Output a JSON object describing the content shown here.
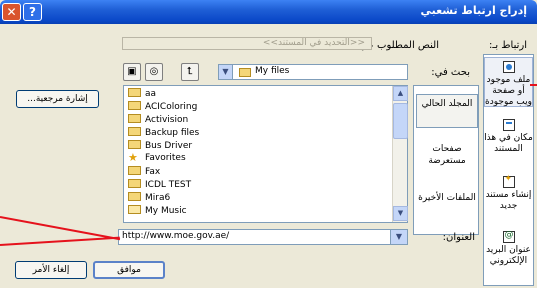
{
  "title_bar": {
    "title": "إدراج ارتباط تشعبي",
    "help_glyph": "?",
    "close_glyph": "✕"
  },
  "labels": {
    "link_to": "ارتباط بـ:",
    "text_to_display": "النص المطلوب عرضه:",
    "look_in": "بحث في:",
    "address": "العنوان:"
  },
  "text_to_display_value": "<<التحديد في المستند>>",
  "link_to_items": [
    {
      "label": "ملف موجود أو صفحة ويب موجودة",
      "icon": "web-page-icon",
      "selected": true
    },
    {
      "label": "مكان في هذا المستند",
      "icon": "document-place-icon",
      "selected": false
    },
    {
      "label": "إنشاء مستند جديد",
      "icon": "new-document-icon",
      "selected": false
    },
    {
      "label": "عنوان البريد الإلكتروني",
      "icon": "email-icon",
      "selected": false
    }
  ],
  "look_in_value": "My files",
  "shortcuts": [
    {
      "label": "المجلد الحالي",
      "selected": true
    },
    {
      "label": "صفحات مستعرضة",
      "selected": false
    },
    {
      "label": "الملفات الأخيرة",
      "selected": false
    }
  ],
  "files": [
    {
      "name": "aa",
      "icon": "folder-icon"
    },
    {
      "name": "ACIColoring",
      "icon": "folder-icon"
    },
    {
      "name": "Activision",
      "icon": "folder-icon"
    },
    {
      "name": "Backup files",
      "icon": "folder-icon"
    },
    {
      "name": "Bus Driver",
      "icon": "folder-icon"
    },
    {
      "name": "Favorites",
      "icon": "favorites-star-icon"
    },
    {
      "name": "Fax",
      "icon": "folder-icon"
    },
    {
      "name": "ICDL TEST",
      "icon": "folder-icon"
    },
    {
      "name": "Mira6",
      "icon": "folder-icon"
    },
    {
      "name": "My Music",
      "icon": "music-folder-icon"
    }
  ],
  "address_value": "http://www.moe.gov.ae/",
  "buttons": {
    "bookmark": "إشارة مرجعية...",
    "ok": "موافق",
    "cancel": "إلغاء الأمر"
  },
  "colors": {
    "titlebar": "#0a48c8",
    "dialog_bg": "#ece9d8",
    "annotation_arrow": "#e5121c"
  }
}
